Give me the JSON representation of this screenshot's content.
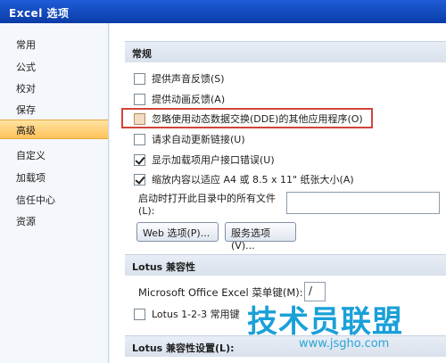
{
  "window": {
    "title": "Excel 选项"
  },
  "sidebar": {
    "items": [
      {
        "label": "常用"
      },
      {
        "label": "公式"
      },
      {
        "label": "校对"
      },
      {
        "label": "保存"
      },
      {
        "label": "高级"
      },
      {
        "label": "自定义"
      },
      {
        "label": "加载项"
      },
      {
        "label": "信任中心"
      },
      {
        "label": "资源"
      }
    ],
    "active_index": 4
  },
  "general": {
    "header": "常规",
    "options": [
      {
        "label": "提供声音反馈(S)",
        "checked": false
      },
      {
        "label": "提供动画反馈(A)",
        "checked": false
      },
      {
        "label": "忽略使用动态数据交换(DDE)的其他应用程序(O)",
        "checked": false
      },
      {
        "label": "请求自动更新链接(U)",
        "checked": true
      },
      {
        "label": "显示加载项用户接口错误(U)",
        "checked": true
      },
      {
        "label": "缩放内容以适应 A4 或 8.5 x 11\" 纸张大小(A)",
        "checked": true
      }
    ],
    "startup_label_1": "启动时打开此目录中的所有文件",
    "startup_label_2": "(L):",
    "startup_value": "",
    "web_options_button": "Web 选项(P)...",
    "service_options_button": "服务选项(V)..."
  },
  "lotus": {
    "header": "Lotus 兼容性",
    "menu_key_label": "Microsoft Office Excel 菜单键(M):",
    "menu_key_value": "/",
    "nav_keys_label": "Lotus 1-2-3 常用键",
    "nav_keys_checked": false
  },
  "lotus_settings": {
    "header": "Lotus 兼容性设置(L):"
  },
  "watermark": {
    "text": "技术员联盟",
    "url": "www.jsgho.com"
  }
}
